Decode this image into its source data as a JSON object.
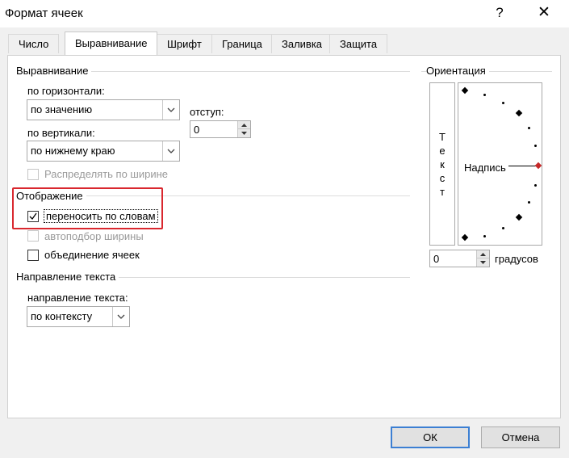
{
  "window": {
    "title": "Формат ячеек",
    "help_glyph": "?",
    "close_glyph": "✕"
  },
  "tabs": [
    {
      "label": "Число"
    },
    {
      "label": "Выравнивание",
      "active": true
    },
    {
      "label": "Шрифт"
    },
    {
      "label": "Граница"
    },
    {
      "label": "Заливка"
    },
    {
      "label": "Защита"
    }
  ],
  "alignment": {
    "group_title": "Выравнивание",
    "horizontal_label": "по горизонтали:",
    "horizontal_value": "по значению",
    "vertical_label": "по вертикали:",
    "vertical_value": "по нижнему краю",
    "indent_label": "отступ:",
    "indent_value": "0",
    "distribute_label": "Распределять по ширине"
  },
  "display": {
    "group_title": "Отображение",
    "wrap_label": "переносить по словам",
    "wrap_checked": true,
    "shrink_label": "автоподбор ширины",
    "merge_label": "объединение ячеек",
    "highlight_color": "#d9272e"
  },
  "direction": {
    "group_title": "Направление текста",
    "label": "направление текста:",
    "value": "по контексту"
  },
  "orientation": {
    "group_title": "Ориентация",
    "vertical_text": [
      "Т",
      "е",
      "к",
      "с",
      "т"
    ],
    "caption": "Надпись",
    "degrees_value": "0",
    "degrees_label": "градусов",
    "accent_color": "#c62828"
  },
  "buttons": {
    "ok": "ОК",
    "cancel": "Отмена",
    "primary_border": "#3c7fd3"
  }
}
